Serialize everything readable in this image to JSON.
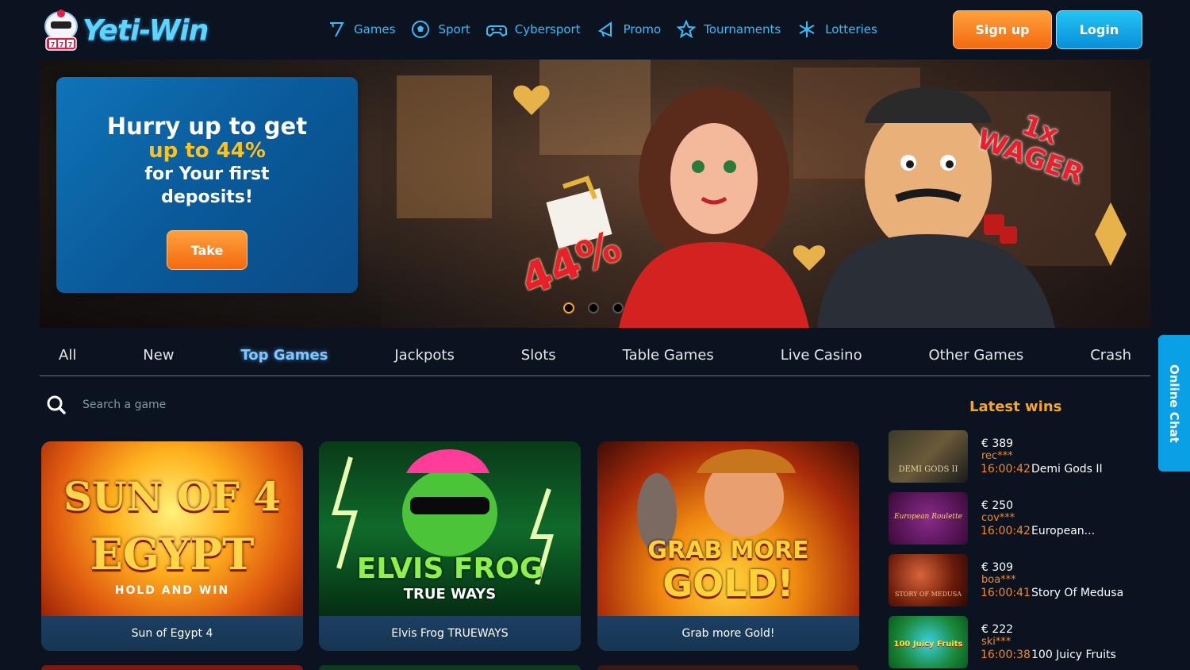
{
  "header": {
    "logo_text": "Yeti-Win",
    "nav": [
      {
        "label": "Games",
        "icon": "seven-icon"
      },
      {
        "label": "Sport",
        "icon": "soccer-ball-icon"
      },
      {
        "label": "Cybersport",
        "icon": "gamepad-icon"
      },
      {
        "label": "Promo",
        "icon": "megaphone-icon"
      },
      {
        "label": "Tournaments",
        "icon": "star-icon"
      },
      {
        "label": "Lotteries",
        "icon": "snowflake-icon"
      }
    ],
    "signup_label": "Sign up",
    "login_label": "Login"
  },
  "banner": {
    "line1": "Hurry up to get",
    "line2": "up to 44%",
    "line3": "for Your first",
    "line4": "deposits!",
    "take_label": "Take",
    "art_percent": "44%",
    "art_wager_1": "1x",
    "art_wager_2": "WAGER",
    "slides": 3,
    "active_slide": 1
  },
  "categories": [
    "All",
    "New",
    "Top Games",
    "Jackpots",
    "Slots",
    "Table Games",
    "Live Casino",
    "Other Games",
    "Crash"
  ],
  "active_category": "Top Games",
  "search": {
    "placeholder": "Search a game"
  },
  "games": [
    {
      "name": "Sun of Egypt 4",
      "art_line1": "SUN OF 4",
      "art_line2": "EGYPT",
      "art_line3": "HOLD AND WIN"
    },
    {
      "name": "Elvis Frog TRUEWAYS",
      "art_line1": "ELVIS FROG",
      "art_line2": "TRUE WAYS"
    },
    {
      "name": "Grab more Gold!",
      "art_line1": "GRAB MORE",
      "art_line2": "GOLD!"
    }
  ],
  "latest_wins": {
    "title": "Latest wins",
    "items": [
      {
        "amount": "€ 389",
        "user": "rec***",
        "time": "16:00:42",
        "game": "Demi Gods II",
        "thumb_text": "DEMI GODS II"
      },
      {
        "amount": "€ 250",
        "user": "cov***",
        "time": "16:00:42",
        "game": "European...",
        "thumb_text": "European Roulette"
      },
      {
        "amount": "€ 309",
        "user": "boa***",
        "time": "16:00:41",
        "game": "Story Of Medusa",
        "thumb_text": "STORY OF MEDUSA"
      },
      {
        "amount": "€ 222",
        "user": "ski***",
        "time": "16:00:38",
        "game": "100 Juicy Fruits",
        "thumb_text": "100 Juicy Fruits"
      }
    ]
  },
  "chat": {
    "label": "Online Chat"
  },
  "colors": {
    "accent": "#f5a623",
    "nav": "#38bdf8",
    "bg": "#0b1321"
  }
}
